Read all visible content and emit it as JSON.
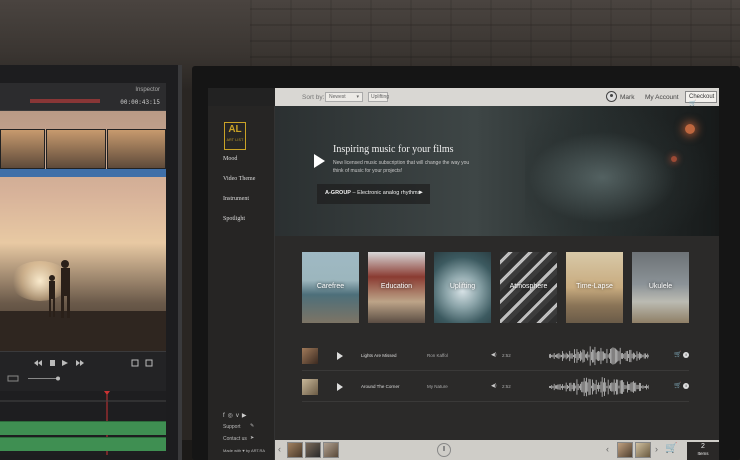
{
  "left_editor": {
    "inspector_label": "Inspector",
    "timecode": "00:00:43:15"
  },
  "artlist": {
    "logo": {
      "mark": "AL",
      "sub": "ART LIST"
    },
    "topbar": {
      "sort_label": "Sort by:",
      "sort_value": "Newest",
      "filter_chip": "Uplifting",
      "user_name": "Mark",
      "my_account": "My Account",
      "checkout": "Checkout"
    },
    "nav": [
      {
        "label": "Mood"
      },
      {
        "label": "Video Theme"
      },
      {
        "label": "Instrument"
      },
      {
        "label": "Spotlight"
      }
    ],
    "social_icons": [
      "facebook-icon",
      "instagram-icon",
      "vimeo-icon",
      "youtube-icon"
    ],
    "footer": {
      "support": "Support",
      "contact": "Contact us",
      "made_with": "Made with ♥ by ART.RA"
    },
    "hero": {
      "title": "Inspiring music for your films",
      "subtitle": "New licensed music subscription that will change the way you think of music for your projects!",
      "playlist_group": "A-GROUP",
      "playlist_name": "Electronic analog rhythms"
    },
    "categories": [
      {
        "label": "Carefree"
      },
      {
        "label": "Education"
      },
      {
        "label": "Uplifting"
      },
      {
        "label": "Atmosphere"
      },
      {
        "label": "Time-Lapse"
      },
      {
        "label": "Ukulele"
      }
    ],
    "tracks": [
      {
        "title": "Lights Are Missed",
        "artist": "Ron Kaffol",
        "duration": "2:52"
      },
      {
        "title": "Around The Corner",
        "artist": "My Nature",
        "duration": "2:52"
      }
    ],
    "cart": {
      "count": "2",
      "unit": "Items"
    }
  }
}
